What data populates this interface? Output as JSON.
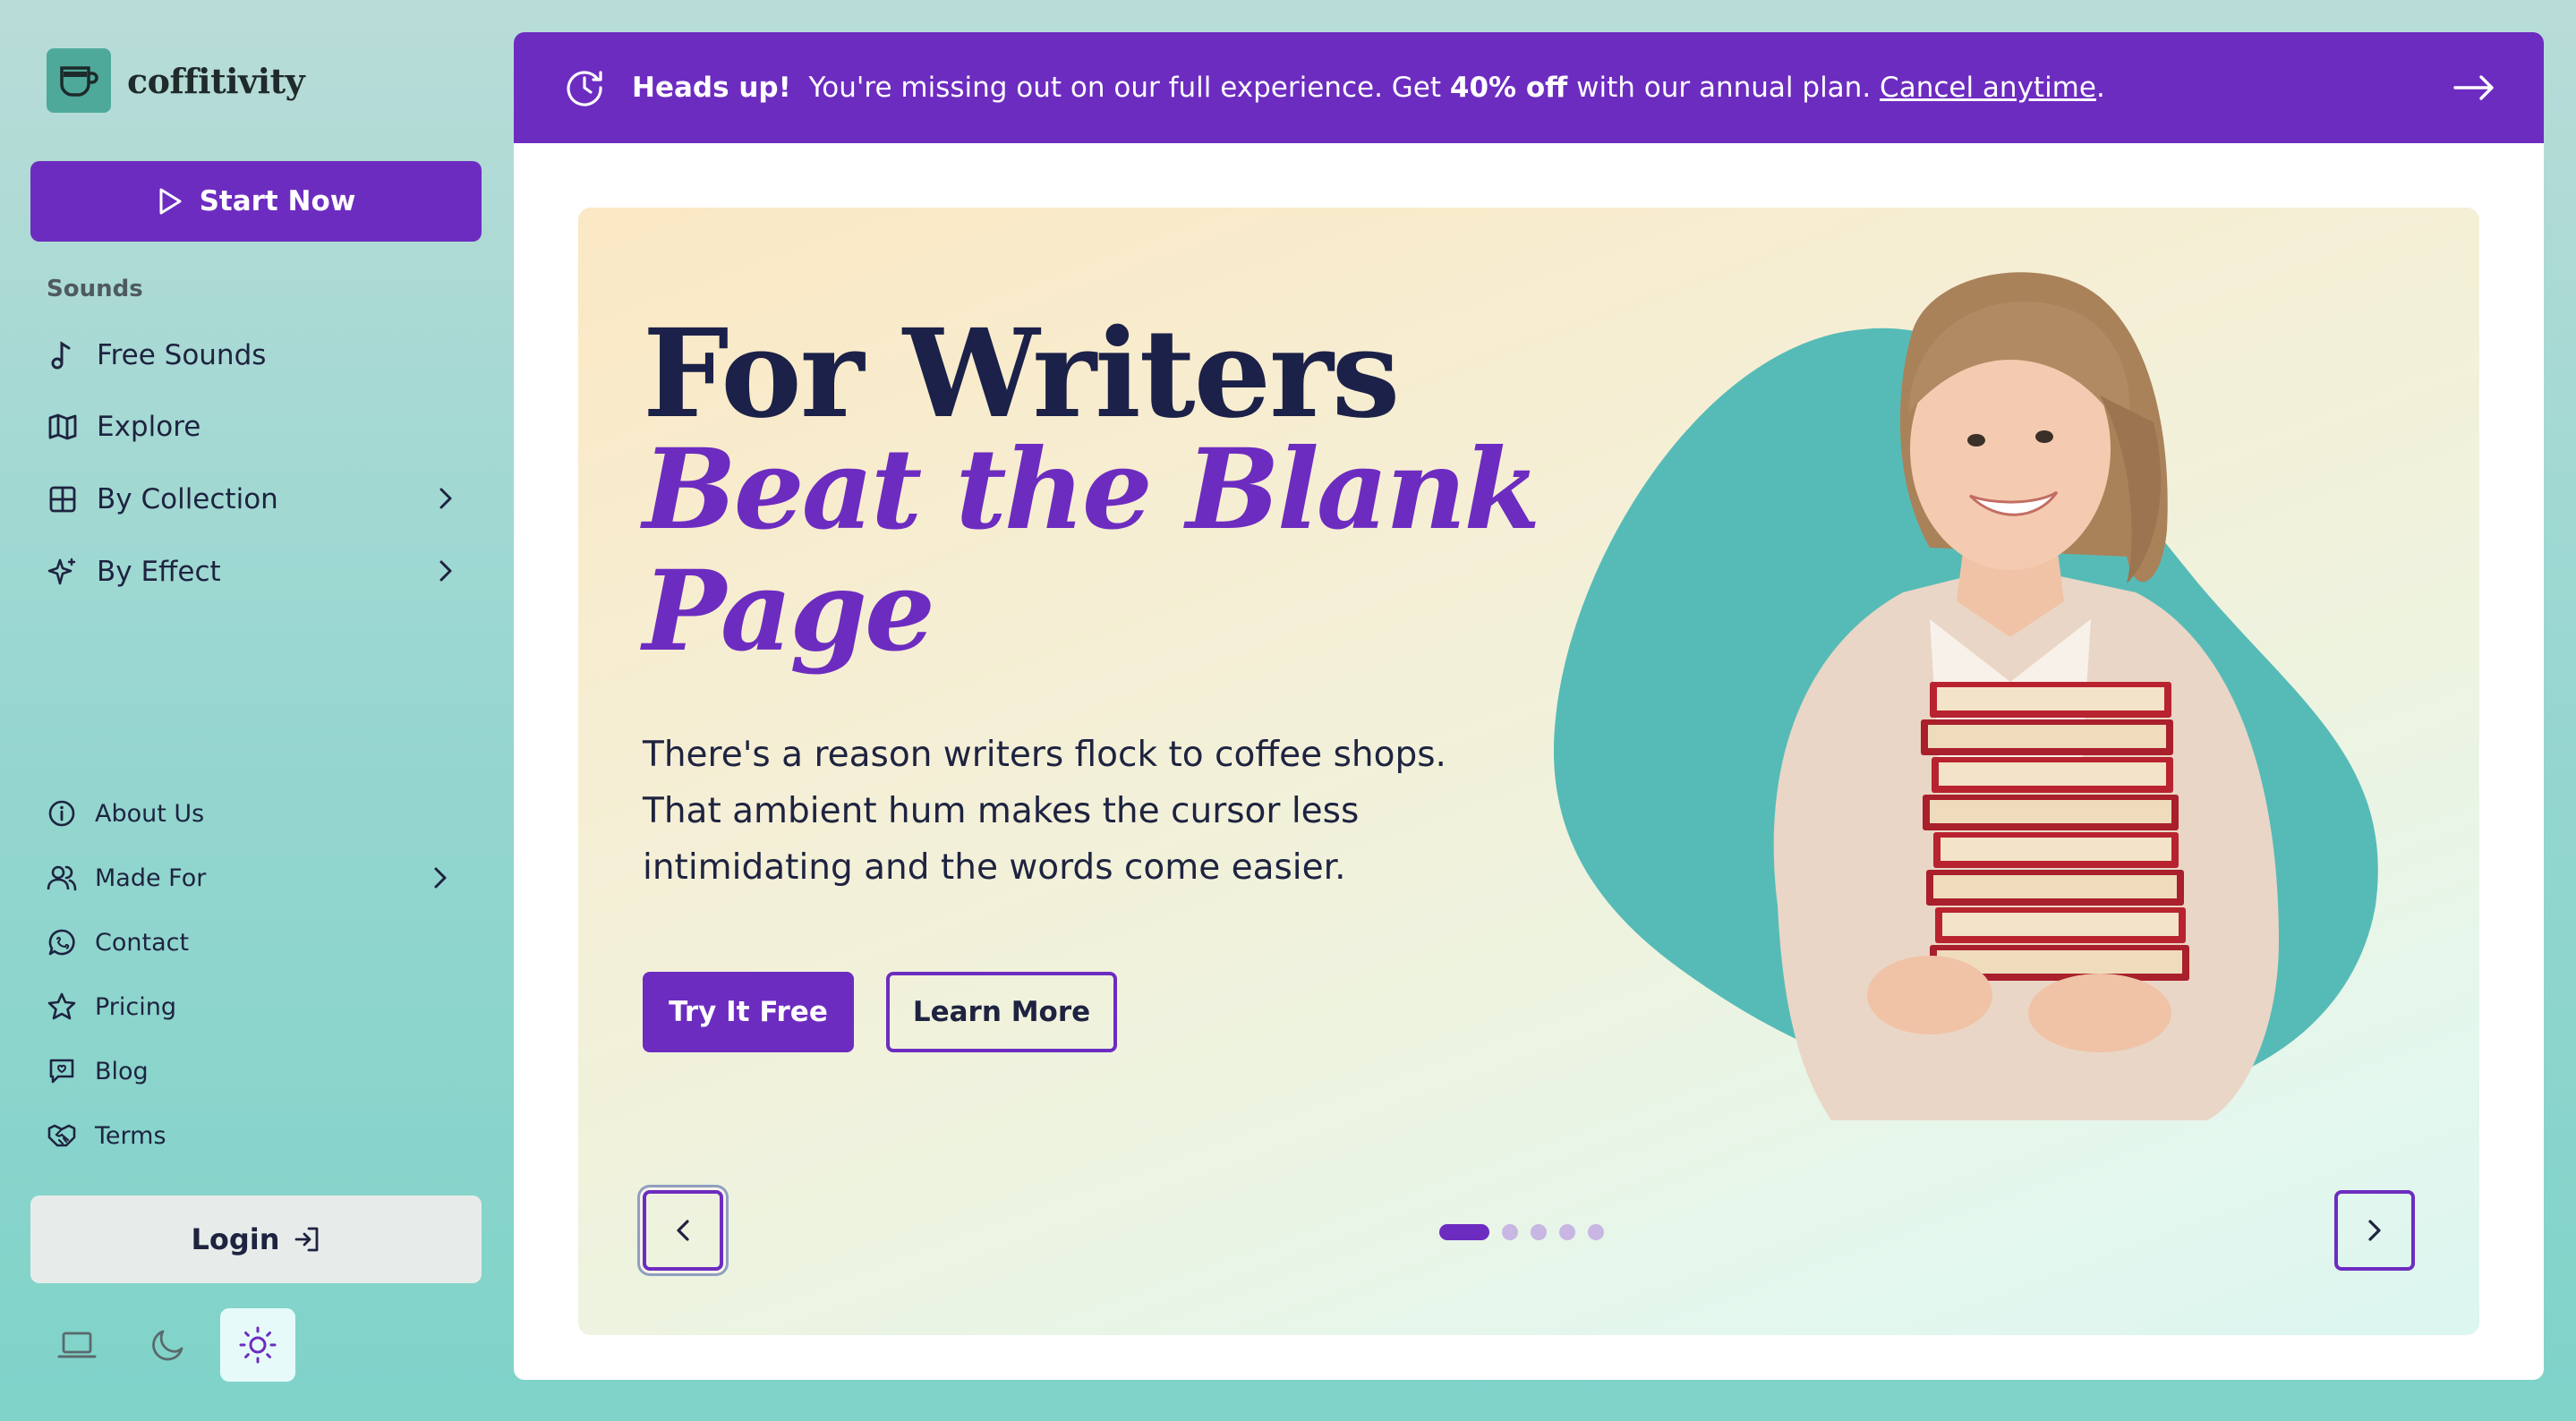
{
  "brand": {
    "name": "coffitivity"
  },
  "sidebar": {
    "start_button": "Start Now",
    "section_label": "Sounds",
    "sound_items": [
      {
        "label": "Free Sounds",
        "icon": "music-note-icon"
      },
      {
        "label": "Explore",
        "icon": "map-icon"
      },
      {
        "label": "By Collection",
        "icon": "grid-icon",
        "has_submenu": true
      },
      {
        "label": "By Effect",
        "icon": "sparkles-icon",
        "has_submenu": true
      }
    ],
    "footer_items": [
      {
        "label": "About Us",
        "icon": "info-icon"
      },
      {
        "label": "Made For",
        "icon": "users-icon",
        "has_submenu": true
      },
      {
        "label": "Contact",
        "icon": "chat-icon"
      },
      {
        "label": "Pricing",
        "icon": "star-icon"
      },
      {
        "label": "Blog",
        "icon": "message-square-icon"
      },
      {
        "label": "Terms",
        "icon": "handshake-icon"
      }
    ],
    "login_button": "Login",
    "theme_options": [
      {
        "name": "system",
        "icon": "laptop-icon",
        "active": false
      },
      {
        "name": "dark",
        "icon": "moon-icon",
        "active": false
      },
      {
        "name": "light",
        "icon": "sun-icon",
        "active": true
      }
    ]
  },
  "banner": {
    "lead": "Heads up!",
    "text_before": "You're missing out on our full experience. Get",
    "highlight": "40% off",
    "text_after": "with our annual plan.",
    "link": "Cancel anytime",
    "trailing": "."
  },
  "hero": {
    "title": "For Writers",
    "subtitle": "Beat the Blank Page",
    "description": "There's a reason writers flock to coffee shops. That ambient hum makes the cursor less intimidating and the words come easier.",
    "primary_button": "Try It Free",
    "secondary_button": "Learn More"
  },
  "carousel": {
    "slide_count": 5,
    "active_index": 0
  },
  "colors": {
    "accent": "#6d2cc0",
    "navy": "#1b2148",
    "teal_blob": "#56bbb7",
    "sidebar_bg": "#94d6cf"
  }
}
